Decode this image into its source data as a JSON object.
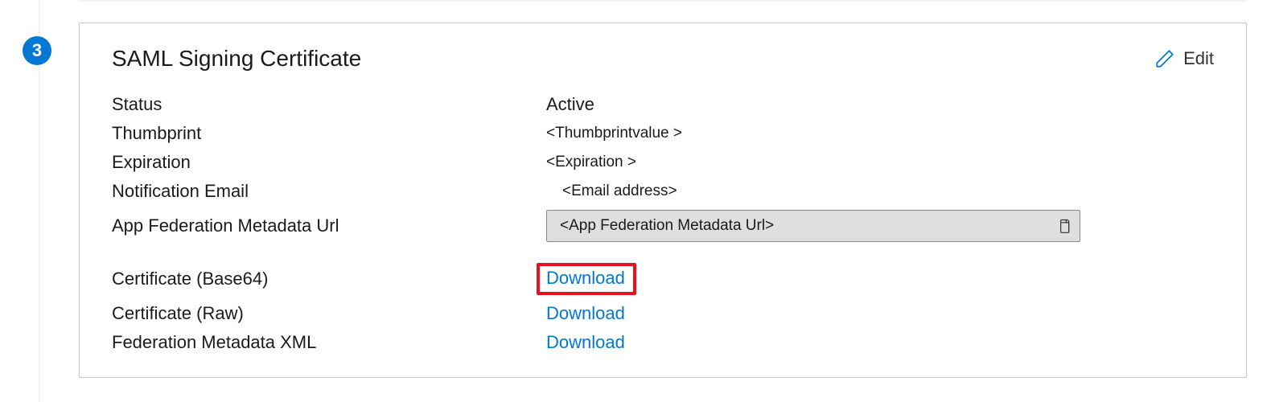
{
  "step": {
    "number": "3"
  },
  "card": {
    "title": "SAML Signing Certificate",
    "edit_label": "Edit"
  },
  "fields": {
    "status_label": "Status",
    "status_value": "Active",
    "thumbprint_label": "Thumbprint",
    "thumbprint_value": "<Thumbprintvalue >",
    "expiration_label": "Expiration",
    "expiration_value": "<Expiration >",
    "notification_label": "Notification Email",
    "notification_value": "<Email address>",
    "metadata_url_label": "App Federation Metadata Url",
    "metadata_url_value": "<App Federation Metadata Url>",
    "cert_base64_label": "Certificate (Base64)",
    "cert_base64_link": "Download",
    "cert_raw_label": "Certificate (Raw)",
    "cert_raw_link": "Download",
    "fed_xml_label": "Federation Metadata XML",
    "fed_xml_link": "Download"
  }
}
